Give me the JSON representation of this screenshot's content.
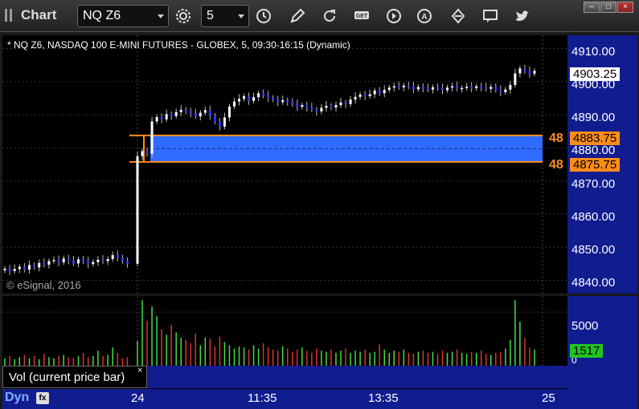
{
  "window": {
    "title": "Chart"
  },
  "toolbar": {
    "symbol": "NQ Z6",
    "interval": "5",
    "icons": [
      "clock-gear-icon",
      "clock-icon",
      "pencil-icon",
      "refresh-icon",
      "get-icon",
      "play-icon",
      "alert-icon",
      "diamond-icon",
      "comment-icon",
      "twitter-icon"
    ]
  },
  "price_pane": {
    "symbol_description": "* NQ Z6, NASDAQ 100 E-MINI FUTURES - GLOBEX, 5, 09:30-16:15 (Dynamic)",
    "copyright": "© eSignal, 2016",
    "axis_ticks": [
      "4910.00",
      "4900.00",
      "4890.00",
      "4880.00",
      "4870.00",
      "4860.00",
      "4850.00",
      "4840.00"
    ],
    "last_price": "4903.25",
    "zone_top_price": "4883.75",
    "zone_bottom_price": "4875.75",
    "zone_top_count": "48",
    "zone_bottom_count": "48",
    "colors": {
      "up": "#ffffff",
      "down": "#2a36ff",
      "zone_fill": "#2f6bff",
      "zone_line": "#ff8c1a"
    }
  },
  "volume_pane": {
    "label": "Vol (current price bar)",
    "close_symbol": "×",
    "axis_ticks": [
      "5000",
      "0"
    ],
    "current_volume": "1517"
  },
  "time_axis": {
    "labels": [
      "24",
      "11:35",
      "13:35",
      "25"
    ],
    "mode_label": "Dyn",
    "mode_icon_text": "fx"
  },
  "chart_data": {
    "type": "candlestick",
    "ylim": [
      4836,
      4914
    ],
    "price_series": [
      4843.5,
      4842.8,
      4843.4,
      4844.1,
      4843.2,
      4844.6,
      4843.9,
      4845.2,
      4844.7,
      4845.8,
      4846.1,
      4845.4,
      4846.6,
      4846.0,
      4845.1,
      4846.3,
      4845.7,
      4844.9,
      4845.5,
      4846.2,
      4845.8,
      4846.4,
      4847.6,
      4846.9,
      4845.8,
      4845.0,
      4877.5,
      4879.0,
      4878.2,
      4888.0,
      4889.3,
      4888.6,
      4890.2,
      4889.6,
      4890.8,
      4891.5,
      4891.0,
      4890.4,
      4889.5,
      4890.6,
      4891.4,
      4889.7,
      4887.9,
      4886.4,
      4889.2,
      4892.5,
      4894.0,
      4894.8,
      4895.6,
      4894.2,
      4895.3,
      4896.5,
      4895.8,
      4895.1,
      4894.6,
      4893.8,
      4894.4,
      4893.9,
      4893.2,
      4892.4,
      4892.9,
      4892.2,
      4891.6,
      4891.0,
      4892.1,
      4892.7,
      4892.2,
      4892.9,
      4893.7,
      4893.2,
      4894.6,
      4895.4,
      4896.1,
      4895.6,
      4896.2,
      4897.3,
      4896.5,
      4897.5,
      4898.2,
      4898.6,
      4898.3,
      4898.8,
      4898.5,
      4897.7,
      4898.4,
      4898.0,
      4897.6,
      4898.3,
      4898.0,
      4897.4,
      4898.2,
      4898.6,
      4897.9,
      4898.1,
      4898.5,
      4898.0,
      4898.6,
      4898.2,
      4897.8,
      4898.4,
      4897.5,
      4896.8,
      4897.6,
      4899.0,
      4902.5,
      4904.0,
      4903.2,
      4902.4,
      4903.25
    ],
    "volume_series": [
      700,
      900,
      600,
      800,
      1000,
      700,
      900,
      600,
      1100,
      800,
      700,
      900,
      1000,
      800,
      700,
      900,
      1200,
      800,
      900,
      1400,
      900,
      1000,
      1700,
      1200,
      700,
      800,
      2300,
      6100,
      4200,
      5500,
      4600,
      3400,
      2900,
      3800,
      3100,
      2600,
      2400,
      2100,
      3000,
      1900,
      2600,
      2500,
      1800,
      2700,
      2200,
      1900,
      1600,
      1800,
      1700,
      1500,
      1900,
      1600,
      2100,
      1700,
      1500,
      1400,
      1800,
      1600,
      1300,
      1500,
      1700,
      1400,
      1200,
      1600,
      1400,
      1300,
      1500,
      1200,
      1400,
      1600,
      1200,
      1400,
      1300,
      1500,
      1200,
      1300,
      2000,
      1500,
      1200,
      1400,
      1300,
      1500,
      1200,
      1100,
      1300,
      1400,
      1200,
      1300,
      1100,
      1400,
      1200,
      1300,
      1500,
      1200,
      1100,
      1300,
      1200,
      1400,
      1100,
      1000,
      1200,
      1300,
      1600,
      2400,
      6100,
      4100,
      2600,
      1700,
      1517
    ],
    "volume_ylim": [
      0,
      6500
    ],
    "zone": {
      "low": 4875.75,
      "high": 4883.75
    }
  }
}
